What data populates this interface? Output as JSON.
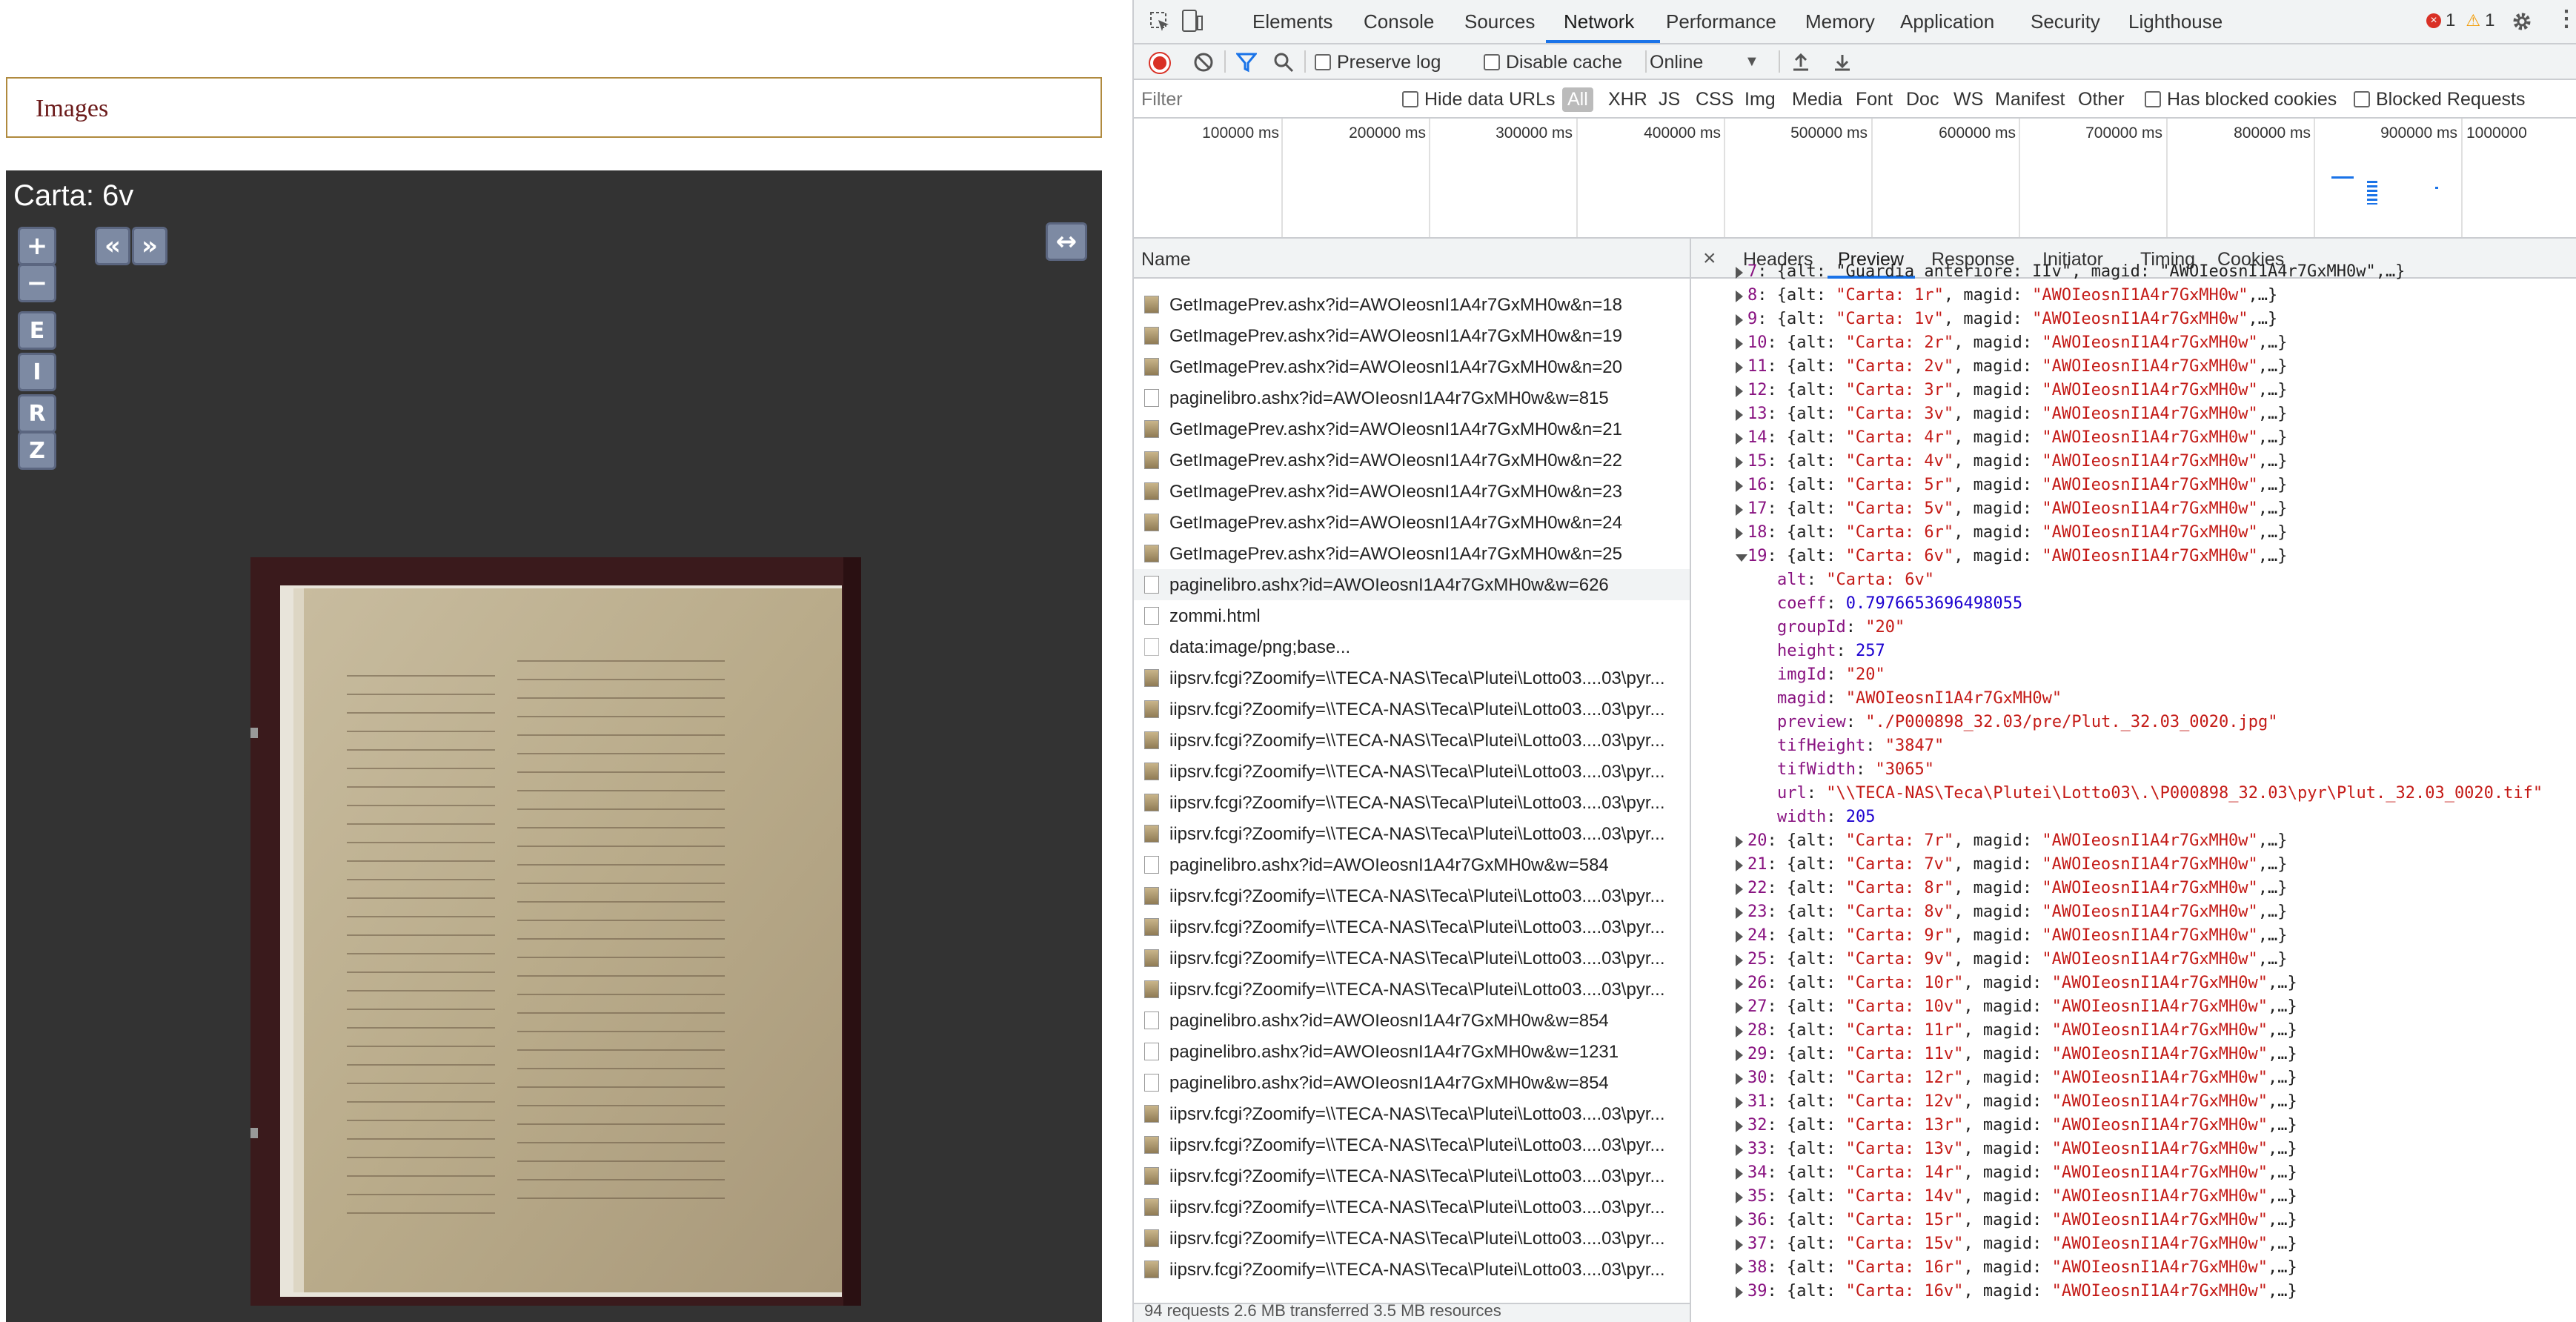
{
  "left_page": {
    "section_label": "Images",
    "viewer": {
      "title": "Carta: 6v",
      "zoom_in": "+",
      "zoom_out": "−",
      "prev": "«",
      "next": "»",
      "fit": "↔",
      "buttons": [
        "E",
        "I",
        "R",
        "Z"
      ]
    }
  },
  "devtools": {
    "tabs": [
      "Elements",
      "Console",
      "Sources",
      "Network",
      "Performance",
      "Memory",
      "Application",
      "Security",
      "Lighthouse"
    ],
    "active_tab": "Network",
    "errors": "1",
    "warnings": "1",
    "toolbar": {
      "preserve_log": "Preserve log",
      "disable_cache": "Disable cache",
      "throttle": "Online"
    },
    "filter": {
      "placeholder": "Filter",
      "hide_data_urls": "Hide data URLs",
      "types": [
        "All",
        "XHR",
        "JS",
        "CSS",
        "Img",
        "Media",
        "Font",
        "Doc",
        "WS",
        "Manifest",
        "Other"
      ],
      "has_blocked_cookies": "Has blocked cookies",
      "blocked_requests": "Blocked Requests"
    },
    "timeline_ticks": [
      "100000 ms",
      "200000 ms",
      "300000 ms",
      "400000 ms",
      "500000 ms",
      "600000 ms",
      "700000 ms",
      "800000 ms",
      "900000 ms",
      "1000000"
    ],
    "name_header": "Name",
    "requests": [
      {
        "name": "GetImagePrev.ashx?id=AWOIeosnI1A4r7GxMH0w&n=18",
        "type": "img"
      },
      {
        "name": "GetImagePrev.ashx?id=AWOIeosnI1A4r7GxMH0w&n=19",
        "type": "img"
      },
      {
        "name": "GetImagePrev.ashx?id=AWOIeosnI1A4r7GxMH0w&n=20",
        "type": "img"
      },
      {
        "name": "paginelibro.ashx?id=AWOIeosnI1A4r7GxMH0w&w=815",
        "type": "doc"
      },
      {
        "name": "GetImagePrev.ashx?id=AWOIeosnI1A4r7GxMH0w&n=21",
        "type": "img"
      },
      {
        "name": "GetImagePrev.ashx?id=AWOIeosnI1A4r7GxMH0w&n=22",
        "type": "img"
      },
      {
        "name": "GetImagePrev.ashx?id=AWOIeosnI1A4r7GxMH0w&n=23",
        "type": "img"
      },
      {
        "name": "GetImagePrev.ashx?id=AWOIeosnI1A4r7GxMH0w&n=24",
        "type": "img"
      },
      {
        "name": "GetImagePrev.ashx?id=AWOIeosnI1A4r7GxMH0w&n=25",
        "type": "img"
      },
      {
        "name": "paginelibro.ashx?id=AWOIeosnI1A4r7GxMH0w&w=626",
        "type": "doc"
      },
      {
        "name": "zommi.html",
        "type": "doc"
      },
      {
        "name": "data:image/png;base...",
        "type": "data"
      },
      {
        "name": "iipsrv.fcgi?Zoomify=\\\\TECA-NAS\\Teca\\Plutei\\Lotto03....03\\pyr...",
        "type": "img"
      },
      {
        "name": "iipsrv.fcgi?Zoomify=\\\\TECA-NAS\\Teca\\Plutei\\Lotto03....03\\pyr...",
        "type": "img"
      },
      {
        "name": "iipsrv.fcgi?Zoomify=\\\\TECA-NAS\\Teca\\Plutei\\Lotto03....03\\pyr...",
        "type": "img"
      },
      {
        "name": "iipsrv.fcgi?Zoomify=\\\\TECA-NAS\\Teca\\Plutei\\Lotto03....03\\pyr...",
        "type": "img"
      },
      {
        "name": "iipsrv.fcgi?Zoomify=\\\\TECA-NAS\\Teca\\Plutei\\Lotto03....03\\pyr...",
        "type": "img"
      },
      {
        "name": "iipsrv.fcgi?Zoomify=\\\\TECA-NAS\\Teca\\Plutei\\Lotto03....03\\pyr...",
        "type": "img"
      },
      {
        "name": "paginelibro.ashx?id=AWOIeosnI1A4r7GxMH0w&w=584",
        "type": "doc"
      },
      {
        "name": "iipsrv.fcgi?Zoomify=\\\\TECA-NAS\\Teca\\Plutei\\Lotto03....03\\pyr...",
        "type": "img"
      },
      {
        "name": "iipsrv.fcgi?Zoomify=\\\\TECA-NAS\\Teca\\Plutei\\Lotto03....03\\pyr...",
        "type": "img"
      },
      {
        "name": "iipsrv.fcgi?Zoomify=\\\\TECA-NAS\\Teca\\Plutei\\Lotto03....03\\pyr...",
        "type": "img"
      },
      {
        "name": "iipsrv.fcgi?Zoomify=\\\\TECA-NAS\\Teca\\Plutei\\Lotto03....03\\pyr...",
        "type": "img"
      },
      {
        "name": "paginelibro.ashx?id=AWOIeosnI1A4r7GxMH0w&w=854",
        "type": "doc"
      },
      {
        "name": "paginelibro.ashx?id=AWOIeosnI1A4r7GxMH0w&w=1231",
        "type": "doc"
      },
      {
        "name": "paginelibro.ashx?id=AWOIeosnI1A4r7GxMH0w&w=854",
        "type": "doc"
      },
      {
        "name": "iipsrv.fcgi?Zoomify=\\\\TECA-NAS\\Teca\\Plutei\\Lotto03....03\\pyr...",
        "type": "img"
      },
      {
        "name": "iipsrv.fcgi?Zoomify=\\\\TECA-NAS\\Teca\\Plutei\\Lotto03....03\\pyr...",
        "type": "img"
      },
      {
        "name": "iipsrv.fcgi?Zoomify=\\\\TECA-NAS\\Teca\\Plutei\\Lotto03....03\\pyr...",
        "type": "img"
      },
      {
        "name": "iipsrv.fcgi?Zoomify=\\\\TECA-NAS\\Teca\\Plutei\\Lotto03....03\\pyr...",
        "type": "img"
      },
      {
        "name": "iipsrv.fcgi?Zoomify=\\\\TECA-NAS\\Teca\\Plutei\\Lotto03....03\\pyr...",
        "type": "img"
      },
      {
        "name": "iipsrv.fcgi?Zoomify=\\\\TECA-NAS\\Teca\\Plutei\\Lotto03....03\\pyr...",
        "type": "img"
      }
    ],
    "footer": "94 requests   2.6 MB transferred   3.5 MB resources",
    "preview_tabs": [
      "Headers",
      "Preview",
      "Response",
      "Initiator",
      "Timing",
      "Cookies"
    ],
    "active_preview_tab": "Preview",
    "preview_top": "7: {alt: \"Guardia anteriore: IIv\", magid: \"AWOIeosnI1A4r7GxMH0w\",…}",
    "preview_collapsed_before": [
      {
        "i": "8",
        "alt": "Carta: 1r"
      },
      {
        "i": "9",
        "alt": "Carta: 1v"
      },
      {
        "i": "10",
        "alt": "Carta: 2r"
      },
      {
        "i": "11",
        "alt": "Carta: 2v"
      },
      {
        "i": "12",
        "alt": "Carta: 3r"
      },
      {
        "i": "13",
        "alt": "Carta: 3v"
      },
      {
        "i": "14",
        "alt": "Carta: 4r"
      },
      {
        "i": "15",
        "alt": "Carta: 4v"
      },
      {
        "i": "16",
        "alt": "Carta: 5r"
      },
      {
        "i": "17",
        "alt": "Carta: 5v"
      },
      {
        "i": "18",
        "alt": "Carta: 6r"
      }
    ],
    "magid": "AWOIeosnI1A4r7GxMH0w",
    "expanded": {
      "i": "19",
      "header_alt": "Carta: 6v",
      "fields": [
        {
          "key": "alt",
          "value": "\"Carta: 6v\"",
          "kind": "string"
        },
        {
          "key": "coeff",
          "value": "0.7976653696498055",
          "kind": "number"
        },
        {
          "key": "groupId",
          "value": "\"20\"",
          "kind": "string"
        },
        {
          "key": "height",
          "value": "257",
          "kind": "number"
        },
        {
          "key": "imgId",
          "value": "\"20\"",
          "kind": "string"
        },
        {
          "key": "magid",
          "value": "\"AWOIeosnI1A4r7GxMH0w\"",
          "kind": "string"
        },
        {
          "key": "preview",
          "value": "\"./P000898_32.03/pre/Plut._32.03_0020.jpg\"",
          "kind": "string"
        },
        {
          "key": "tifHeight",
          "value": "\"3847\"",
          "kind": "string"
        },
        {
          "key": "tifWidth",
          "value": "\"3065\"",
          "kind": "string"
        },
        {
          "key": "url",
          "value": "\"\\\\TECA-NAS\\Teca\\Plutei\\Lotto03\\.\\P000898_32.03\\pyr\\Plut._32.03_0020.tif\"",
          "kind": "string"
        },
        {
          "key": "width",
          "value": "205",
          "kind": "number"
        }
      ]
    },
    "preview_collapsed_after": [
      {
        "i": "20",
        "alt": "Carta: 7r"
      },
      {
        "i": "21",
        "alt": "Carta: 7v"
      },
      {
        "i": "22",
        "alt": "Carta: 8r"
      },
      {
        "i": "23",
        "alt": "Carta: 8v"
      },
      {
        "i": "24",
        "alt": "Carta: 9r"
      },
      {
        "i": "25",
        "alt": "Carta: 9v"
      },
      {
        "i": "26",
        "alt": "Carta: 10r"
      },
      {
        "i": "27",
        "alt": "Carta: 10v"
      },
      {
        "i": "28",
        "alt": "Carta: 11r"
      },
      {
        "i": "29",
        "alt": "Carta: 11v"
      },
      {
        "i": "30",
        "alt": "Carta: 12r"
      },
      {
        "i": "31",
        "alt": "Carta: 12v"
      },
      {
        "i": "32",
        "alt": "Carta: 13r"
      },
      {
        "i": "33",
        "alt": "Carta: 13v"
      },
      {
        "i": "34",
        "alt": "Carta: 14r"
      },
      {
        "i": "35",
        "alt": "Carta: 14v"
      },
      {
        "i": "36",
        "alt": "Carta: 15r"
      },
      {
        "i": "37",
        "alt": "Carta: 15v"
      },
      {
        "i": "38",
        "alt": "Carta: 16r"
      },
      {
        "i": "39",
        "alt": "Carta: 16v"
      }
    ]
  }
}
